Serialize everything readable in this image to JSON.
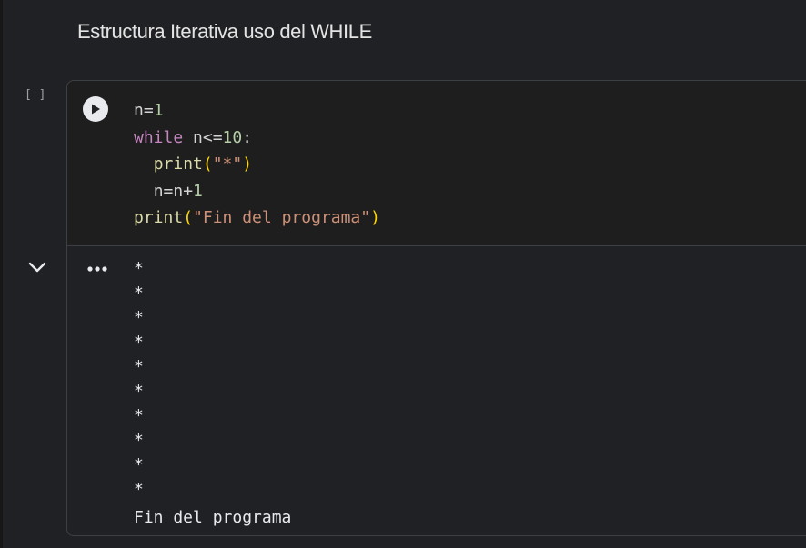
{
  "text_cell": {
    "heading": "Estructura Iterativa uso del WHILE"
  },
  "code_cell": {
    "execution_count": "[ ]",
    "run_icon": "play-circle-icon",
    "lines": {
      "l1_var": "n=",
      "l1_num": "1",
      "l2_kw": "while",
      "l2_cond": " n<=",
      "l2_num": "10",
      "l2_colon": ":",
      "l3_indent": "  ",
      "l3_fn": "print",
      "l3_open": "(",
      "l3_str": "\"*\"",
      "l3_close": ")",
      "l4_indent": "  ",
      "l4_expr": "n=n+",
      "l4_num": "1",
      "l5_fn": "print",
      "l5_open": "(",
      "l5_str": "\"Fin del programa\"",
      "l5_close": ")"
    }
  },
  "output": {
    "collapse_icon": "chevron-down-icon",
    "menu_icon": "more-horiz-icon",
    "stars": [
      "*",
      "*",
      "*",
      "*",
      "*",
      "*",
      "*",
      "*",
      "*",
      "*"
    ],
    "final_line": "Fin del programa"
  },
  "colors": {
    "background": "#202124",
    "editor_background": "#1e1e1e",
    "keyword": "#c586c0",
    "number": "#b5cea8",
    "function": "#dcdcaa",
    "string": "#ce9178",
    "bracket": "#ffd700"
  }
}
